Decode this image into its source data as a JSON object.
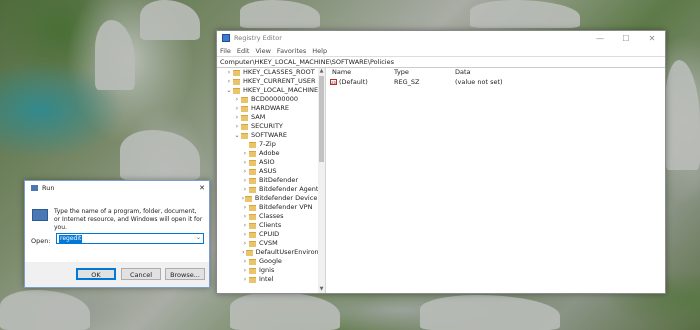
{
  "regedit": {
    "title": "Registry Editor",
    "window_controls": {
      "minimize": "—",
      "maximize": "☐",
      "close": "✕"
    },
    "menu": [
      "File",
      "Edit",
      "View",
      "Favorites",
      "Help"
    ],
    "address": "Computer\\HKEY_LOCAL_MACHINE\\SOFTWARE\\Policies",
    "tree": [
      {
        "label": "HKEY_CLASSES_ROOT",
        "arrow": "›",
        "level": 0
      },
      {
        "label": "HKEY_CURRENT_USER",
        "arrow": "›",
        "level": 0
      },
      {
        "label": "HKEY_LOCAL_MACHINE",
        "arrow": "⌄",
        "level": 0
      },
      {
        "label": "BCD00000000",
        "arrow": "›",
        "level": 1
      },
      {
        "label": "HARDWARE",
        "arrow": "›",
        "level": 1
      },
      {
        "label": "SAM",
        "arrow": "›",
        "level": 1
      },
      {
        "label": "SECURITY",
        "arrow": "›",
        "level": 1
      },
      {
        "label": "SOFTWARE",
        "arrow": "⌄",
        "level": 1
      },
      {
        "label": "7-Zip",
        "arrow": "",
        "level": 2
      },
      {
        "label": "Adobe",
        "arrow": "›",
        "level": 2
      },
      {
        "label": "ASIO",
        "arrow": "›",
        "level": 2
      },
      {
        "label": "ASUS",
        "arrow": "›",
        "level": 2
      },
      {
        "label": "BitDefender",
        "arrow": "›",
        "level": 2
      },
      {
        "label": "Bitdefender Agent",
        "arrow": "›",
        "level": 2
      },
      {
        "label": "Bitdefender Device M",
        "arrow": "›",
        "level": 2
      },
      {
        "label": "Bitdefender VPN",
        "arrow": "›",
        "level": 2
      },
      {
        "label": "Classes",
        "arrow": "›",
        "level": 2
      },
      {
        "label": "Clients",
        "arrow": "›",
        "level": 2
      },
      {
        "label": "CPUID",
        "arrow": "›",
        "level": 2
      },
      {
        "label": "CVSM",
        "arrow": "›",
        "level": 2
      },
      {
        "label": "DefaultUserEnvironm",
        "arrow": "›",
        "level": 2
      },
      {
        "label": "Google",
        "arrow": "›",
        "level": 2
      },
      {
        "label": "Ignis",
        "arrow": "›",
        "level": 2
      },
      {
        "label": "Intel",
        "arrow": "›",
        "level": 2
      }
    ],
    "columns": {
      "name": "Name",
      "type": "Type",
      "data": "Data"
    },
    "values": [
      {
        "icon": "ab",
        "name": "(Default)",
        "type": "REG_SZ",
        "data": "(value not set)"
      }
    ],
    "scroll": {
      "up": "▲",
      "down": "▼"
    }
  },
  "run_dialog": {
    "title": "Run",
    "close": "✕",
    "description": "Type the name of a program, folder, document, or Internet resource, and Windows will open it for you.",
    "open_label": "Open:",
    "open_value": "regedit",
    "dropdown_chevron": "⌄",
    "buttons": {
      "ok": "OK",
      "cancel": "Cancel",
      "browse": "Browse..."
    }
  }
}
